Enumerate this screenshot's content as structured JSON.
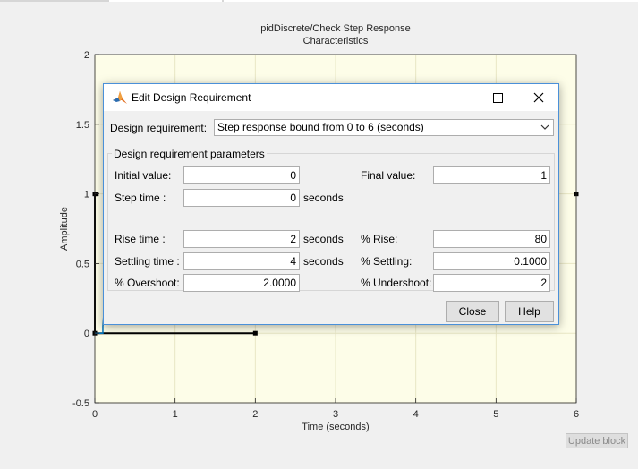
{
  "figure": {
    "title_line1": "pidDiscrete/Check Step Response",
    "title_line2": "Characteristics",
    "xlabel": "Time (seconds)",
    "ylabel": "Amplitude"
  },
  "update_button": "Update block",
  "dialog": {
    "title": "Edit Design Requirement",
    "icon": "matlab-icon",
    "requirement_label": "Design requirement:",
    "requirement_value": "Step response bound from 0 to 6 (seconds)",
    "group_title": "Design requirement parameters",
    "fields": {
      "initial_value": {
        "label": "Initial value:",
        "value": "0"
      },
      "final_value": {
        "label": "Final value:",
        "value": "1"
      },
      "step_time": {
        "label": "Step time :",
        "value": "0",
        "unit": "seconds"
      },
      "rise_time": {
        "label": "Rise time :",
        "value": "2",
        "unit": "seconds"
      },
      "pct_rise": {
        "label": "% Rise:",
        "value": "80"
      },
      "settling_time": {
        "label": "Settling time :",
        "value": "4",
        "unit": "seconds"
      },
      "pct_settling": {
        "label": "% Settling:",
        "value": "0.1000"
      },
      "pct_overshoot": {
        "label": "% Overshoot:",
        "value": "2.0000"
      },
      "pct_undershoot": {
        "label": "% Undershoot:",
        "value": "2"
      }
    },
    "close_label": "Close",
    "help_label": "Help"
  },
  "chart_data": {
    "type": "line",
    "title": "pidDiscrete/Check Step Response Characteristics",
    "xlabel": "Time (seconds)",
    "ylabel": "Amplitude",
    "xlim": [
      0,
      6
    ],
    "ylim": [
      -0.5,
      2
    ],
    "xticks": [
      0,
      1,
      2,
      3,
      4,
      5,
      6
    ],
    "yticks": [
      -0.5,
      0,
      0.5,
      1,
      1.5,
      2
    ],
    "ytick_labels": [
      "-0.5",
      "0",
      "0.5",
      "1",
      "1.5",
      "2"
    ],
    "background": "#fdfde8",
    "grid": true,
    "bounds": [
      {
        "x": [
          0,
          0,
          2
        ],
        "y": [
          1,
          0,
          0
        ]
      },
      {
        "x": [
          0,
          0.02
        ],
        "y": [
          1,
          1
        ]
      },
      {
        "x": [
          6,
          6
        ],
        "y": [
          1,
          1
        ]
      }
    ],
    "series": [
      {
        "color": "#0072bd",
        "x": [
          0,
          0.1,
          0.1,
          0.12,
          0.14,
          0.2,
          0.22
        ],
        "y": [
          0,
          0,
          0.05,
          0.2,
          0.5,
          1.2,
          1.6
        ]
      }
    ]
  }
}
